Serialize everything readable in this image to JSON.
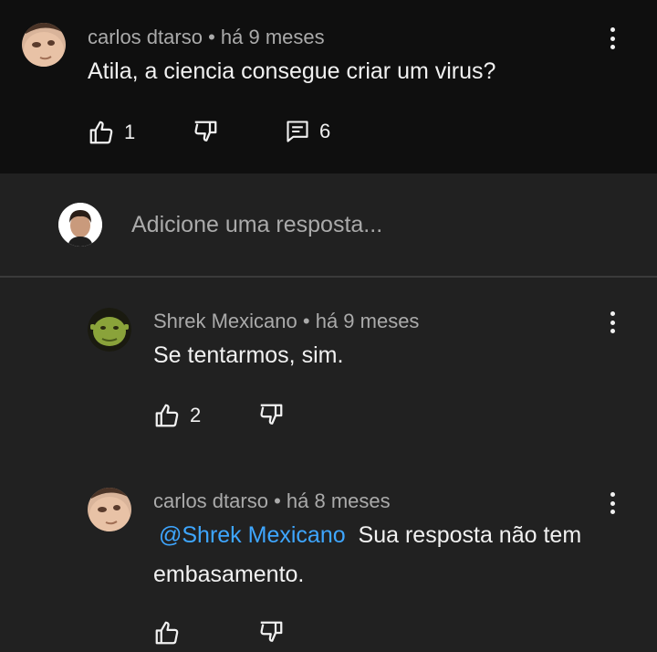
{
  "top_comment": {
    "author": "carlos dtarso",
    "time": "há 9 meses",
    "separator": "•",
    "text": "Atila, a ciencia consegue criar um virus?",
    "likes": "1",
    "replies": "6"
  },
  "reply_box": {
    "placeholder": "Adicione uma resposta..."
  },
  "replies": [
    {
      "author": "Shrek Mexicano",
      "time": "há 9 meses",
      "separator": "•",
      "text": "Se tentarmos, sim.",
      "likes": "2"
    },
    {
      "author": "carlos dtarso",
      "time": "há 8 meses",
      "separator": "•",
      "mention": "@Shrek Mexicano",
      "text_line1": "Sua resposta não tem",
      "text_line2": "embasamento."
    }
  ],
  "icons": {
    "like": "thumbs-up-icon",
    "dislike": "thumbs-down-icon",
    "reply": "comment-icon",
    "more": "more-vert-icon"
  },
  "colors": {
    "background_top": "#0f0f0f",
    "background_thread": "#212121",
    "mention": "#3ea6ff",
    "secondary_text": "#aaaaaa"
  }
}
